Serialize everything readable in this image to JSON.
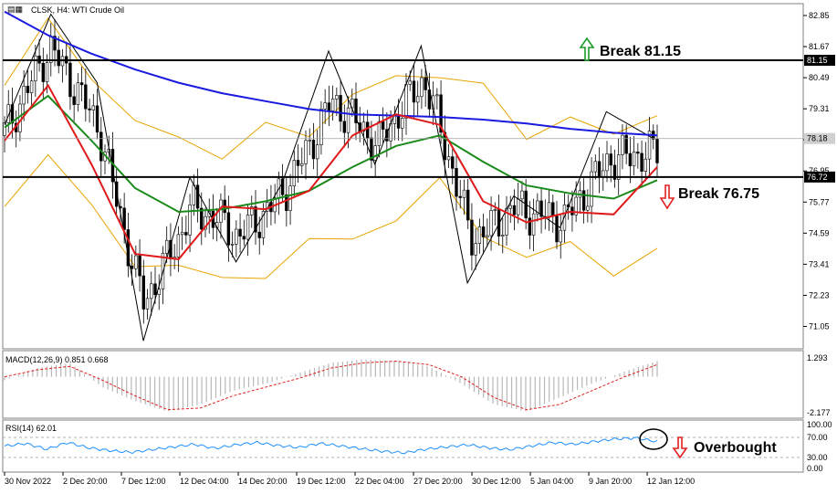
{
  "header": {
    "title": "CLSK, H4: WTI Crude Oil"
  },
  "chart_data": {
    "type": "candlestick",
    "title": "CLSK, H4: WTI Crude Oil",
    "price_axis": {
      "range": [
        70.2,
        83.3
      ],
      "ticks": [
        "82.85",
        "81.67",
        "80.49",
        "79.31",
        "78.13",
        "76.95",
        "75.77",
        "74.59",
        "73.41",
        "72.23",
        "71.05"
      ]
    },
    "time_axis": {
      "labels": [
        "30 Nov 2022",
        "2 Dec 20:00",
        "7 Dec 12:00",
        "12 Dec 04:00",
        "14 Dec 20:00",
        "19 Dec 12:00",
        "22 Dec 04:00",
        "27 Dec 20:00",
        "30 Dec 12:00",
        "5 Jan 04:00",
        "9 Jan 20:00",
        "12 Jan 12:00"
      ]
    },
    "horizontal_levels": [
      {
        "value": 81.15,
        "label": "81.15",
        "annotation": "Break 81.15",
        "arrow": "up",
        "color": "#1a9c2a"
      },
      {
        "value": 76.72,
        "label": "76.72",
        "annotation": "Break 76.75",
        "arrow": "down",
        "color": "#e02020"
      }
    ],
    "current_price": {
      "value": 78.18,
      "label": "78.18"
    },
    "moving_averages": [
      {
        "color": "#1a1ae0",
        "values": [
          83.0,
          82.1,
          81.4,
          80.8,
          80.3,
          79.9,
          79.6,
          79.3,
          79.1,
          79.05,
          79.0,
          78.9,
          78.75,
          78.55,
          78.4,
          78.3
        ]
      },
      {
        "color": "#1a8a1a",
        "values": [
          78.6,
          79.8,
          78.1,
          76.3,
          75.4,
          75.5,
          75.8,
          76.2,
          77.1,
          77.9,
          78.3,
          77.3,
          76.4,
          76.1,
          75.9,
          76.6
        ]
      },
      {
        "color": "#e01a1a",
        "values": [
          78.1,
          80.2,
          77.2,
          73.8,
          73.6,
          75.6,
          75.5,
          76.2,
          78.3,
          79.1,
          78.7,
          75.8,
          75.0,
          75.4,
          75.3,
          77.1
        ]
      }
    ],
    "bollinger_color": "#e8a400",
    "zigzag_points": [
      78.7,
      82.9,
      80.3,
      70.5,
      76.7,
      73.5,
      76.5,
      81.5,
      77.2,
      81.7,
      72.7,
      76.0,
      74.8,
      79.2,
      78.2
    ],
    "macd": {
      "label": "MACD(12,26,9) 0.851 0.668",
      "ticks": [
        "1.293",
        "-2.177"
      ],
      "range": [
        -2.177,
        1.293
      ],
      "histogram": [
        -0.2,
        0.5,
        0.8,
        -0.6,
        -1.4,
        -2.0,
        -1.6,
        -0.8,
        -0.4,
        0.2,
        0.8,
        1.0,
        0.9,
        0.6,
        -0.4,
        -1.6,
        -2.0,
        -1.2,
        -0.4,
        0.3,
        0.9
      ],
      "signal": [
        0.0,
        0.4,
        0.6,
        -0.2,
        -1.1,
        -1.9,
        -1.8,
        -1.1,
        -0.6,
        -0.1,
        0.5,
        0.8,
        0.9,
        0.7,
        0.0,
        -1.2,
        -1.9,
        -1.6,
        -0.8,
        0.0,
        0.7
      ]
    },
    "rsi": {
      "label": "RSI(14) 62.01",
      "ticks": [
        "100.00",
        "70.00",
        "30.00",
        "0.00"
      ],
      "range": [
        0,
        100
      ],
      "values": [
        52,
        58,
        45,
        60,
        48,
        42,
        38,
        44,
        50,
        56,
        47,
        55,
        60,
        53,
        49,
        58,
        52,
        46,
        40,
        37,
        45,
        50,
        55,
        48,
        44,
        52,
        60,
        56,
        62,
        68,
        70,
        62
      ],
      "annotation": "Overbought"
    }
  }
}
